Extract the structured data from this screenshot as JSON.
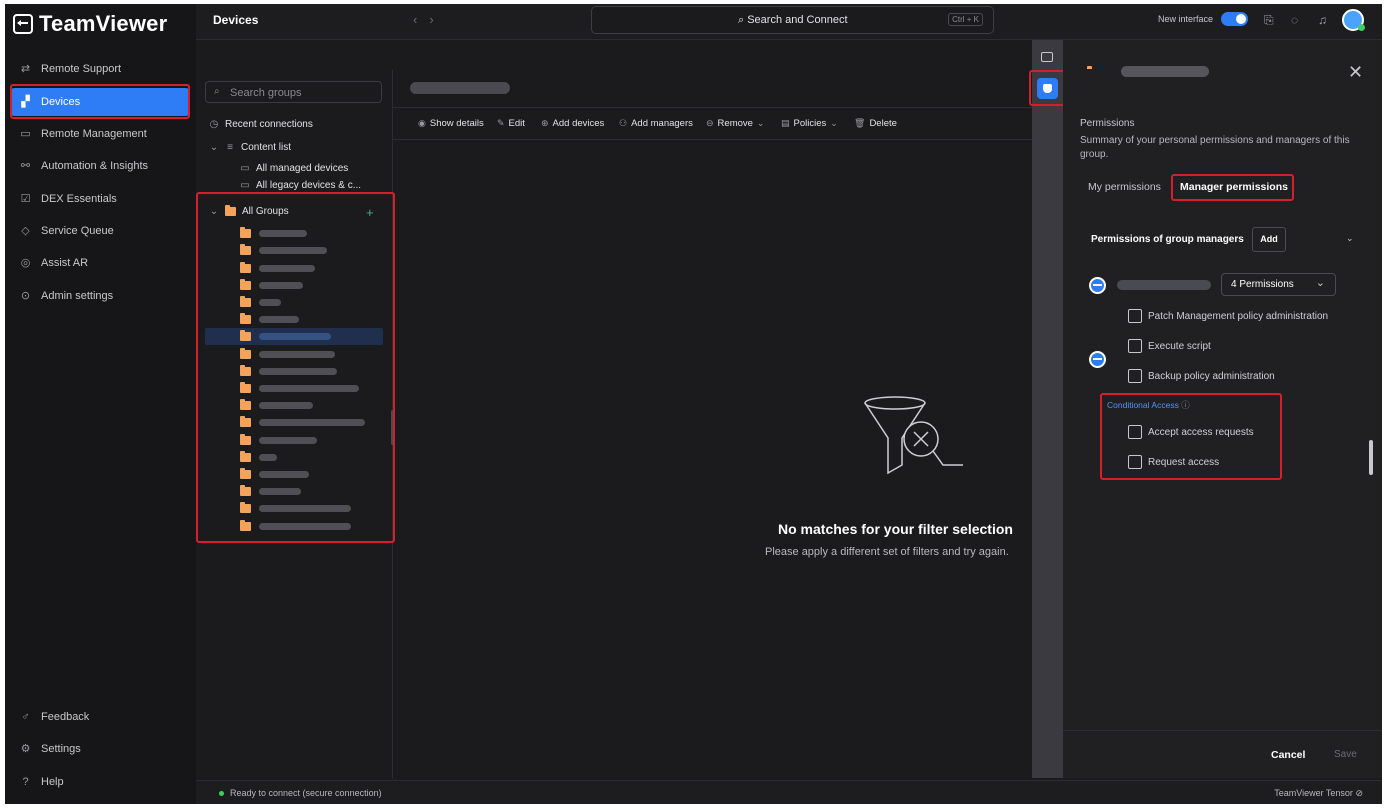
{
  "app": {
    "logo_text": "TeamViewer",
    "section_title": "Devices",
    "search_label": "Search and Connect",
    "search_shortcut": "Ctrl + K",
    "new_interface_label": "New interface"
  },
  "sidebar": {
    "items": [
      {
        "label": "Remote Support",
        "icon": "arrows-icon"
      },
      {
        "label": "Devices",
        "icon": "devices-icon",
        "active": true
      },
      {
        "label": "Remote Management",
        "icon": "monitor-icon"
      },
      {
        "label": "Automation & Insights",
        "icon": "automation-icon"
      },
      {
        "label": "DEX Essentials",
        "icon": "dex-icon"
      },
      {
        "label": "Service Queue",
        "icon": "tag-icon"
      },
      {
        "label": "Assist AR",
        "icon": "ar-icon"
      },
      {
        "label": "Admin settings",
        "icon": "gear-icon"
      }
    ],
    "bottom_items": [
      {
        "label": "Feedback",
        "icon": "feedback-icon"
      },
      {
        "label": "Settings",
        "icon": "gear-icon"
      },
      {
        "label": "Help",
        "icon": "help-icon"
      }
    ]
  },
  "groups": {
    "search_placeholder": "Search groups",
    "recent": "Recent connections",
    "content_list": "Content list",
    "all_managed": "All managed devices",
    "all_legacy": "All legacy devices & c...",
    "all_groups": "All Groups"
  },
  "toolbar": {
    "show_details": "Show details",
    "edit": "Edit",
    "add_devices": "Add devices",
    "add_managers": "Add managers",
    "remove": "Remove",
    "policies": "Policies",
    "delete": "Delete"
  },
  "empty_state": {
    "title": "No matches for your filter selection",
    "subtitle": "Please apply a different set of filters and try again."
  },
  "panel": {
    "section": "Permissions",
    "summary": "Summary of your personal permissions and managers of this group.",
    "tab_my": "My permissions",
    "tab_manager": "Manager permissions",
    "group_managers_title": "Permissions of group managers",
    "add_label": "Add",
    "permissions_dropdown": "4 Permissions",
    "permissions": [
      "Patch Management policy administration",
      "Execute script",
      "Backup policy administration"
    ],
    "conditional_access_title": "Conditional Access",
    "conditional_permissions": [
      "Accept access requests",
      "Request access"
    ],
    "cancel": "Cancel",
    "save": "Save"
  },
  "status": {
    "text": "Ready to connect (secure connection)",
    "tensor": "TeamViewer Tensor"
  },
  "colors": {
    "accent": "#2f7df6",
    "highlight": "#d3202a",
    "folder": "#f5a25a",
    "online": "#3fcf5e"
  }
}
